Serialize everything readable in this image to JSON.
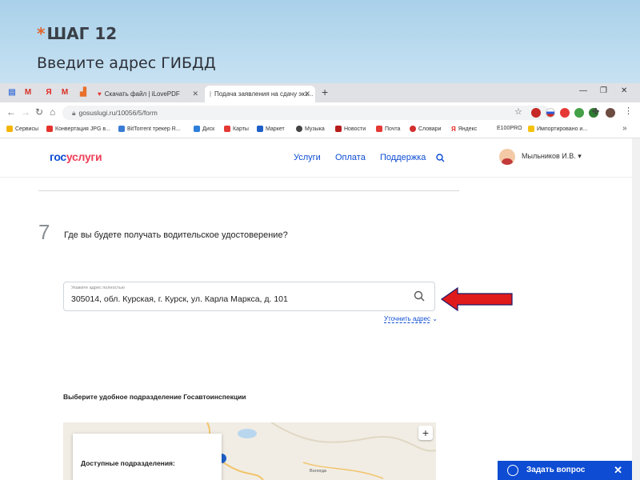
{
  "slide": {
    "star": "*",
    "title": "ШАГ 12",
    "subtitle": "Введите адрес ГИБДД"
  },
  "browser": {
    "tabs": [
      {
        "label": "Скачать файл | iLovePDF",
        "active": false
      },
      {
        "label": "Подача заявления на сдачу экз...",
        "active": true
      }
    ],
    "new_tab": "+",
    "url": "gosuslugi.ru/10056/5/form",
    "bookmarks": [
      "Сервисы",
      "Конвертация JPG в...",
      "BitTorrent трекер R...",
      "Диск",
      "Карты",
      "Маркет",
      "Музыка",
      "Новости",
      "Почта",
      "Словари",
      "Яндекс",
      "E100PRO",
      "Импортировано и..."
    ]
  },
  "gosuslugi": {
    "logo_part1": "гос",
    "logo_part2": "услуги",
    "nav": [
      "Услуги",
      "Оплата",
      "Поддержка"
    ],
    "user": "Мыльников И.В.",
    "user_caret": "▾"
  },
  "form": {
    "step_number": "7",
    "question": "Где вы будете получать водительское удостоверение?",
    "address_label": "Укажите адрес полностью",
    "address_value": "305014, обл. Курская, г. Курск, ул. Карла Маркса, д. 101",
    "clarify_link": "Уточнить адрес ⌄",
    "subdivision_title": "Выберите удобное подразделение Госавтоинспекции",
    "available_title": "Доступные подразделения:",
    "map_labels": [
      "Вологда"
    ]
  },
  "ask_question": {
    "label": "Задать вопрос",
    "close": "✕"
  }
}
